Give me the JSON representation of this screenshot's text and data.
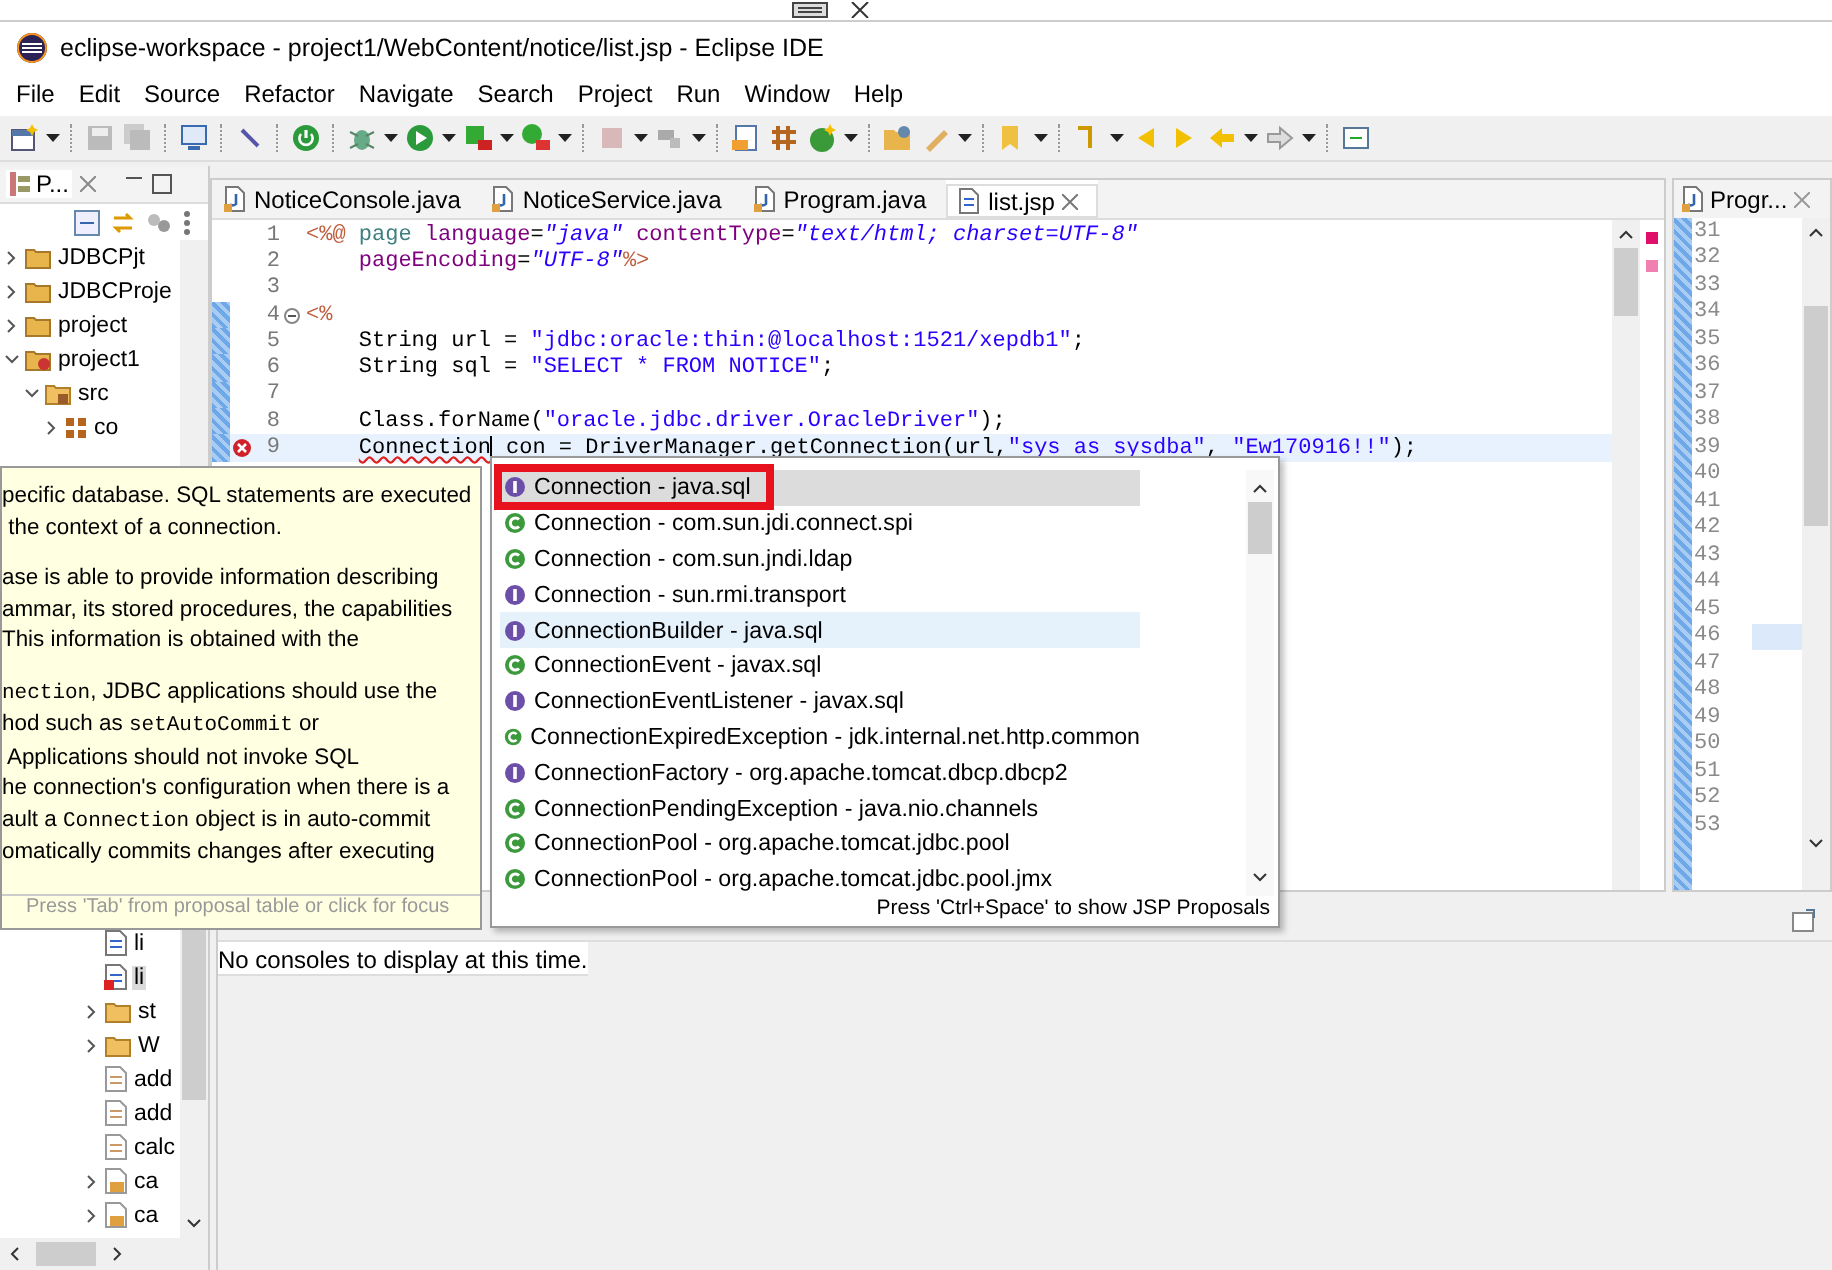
{
  "window": {
    "title": "eclipse-workspace - project1/WebContent/notice/list.jsp - Eclipse IDE"
  },
  "menu": [
    "File",
    "Edit",
    "Source",
    "Refactor",
    "Navigate",
    "Search",
    "Project",
    "Run",
    "Window",
    "Help"
  ],
  "explorer": {
    "tab": "P...",
    "tree": [
      {
        "label": "JDBCPjt",
        "kind": "project",
        "expanded": false,
        "selected": false
      },
      {
        "label": "JDBCProje",
        "kind": "project",
        "expanded": false,
        "selected": false
      },
      {
        "label": "project",
        "kind": "project",
        "expanded": false,
        "selected": false
      },
      {
        "label": "project1",
        "kind": "webproject",
        "expanded": true,
        "selected": false,
        "children": [
          {
            "label": "src",
            "kind": "srcfolder",
            "expanded": true,
            "selected": false,
            "children": [
              {
                "label": "co",
                "kind": "package",
                "expanded": false,
                "selected": false
              }
            ]
          }
        ]
      }
    ],
    "tree_lower": [
      {
        "label": "li",
        "kind": "jsp",
        "selected": false
      },
      {
        "label": "li",
        "kind": "jsperror",
        "selected": true
      },
      {
        "label": "st",
        "kind": "folder",
        "expanded": false,
        "selected": false
      },
      {
        "label": "W",
        "kind": "folder",
        "expanded": false,
        "selected": false
      },
      {
        "label": "add",
        "kind": "file",
        "selected": false
      },
      {
        "label": "add",
        "kind": "file",
        "selected": false
      },
      {
        "label": "calc",
        "kind": "file",
        "selected": false
      },
      {
        "label": "ca",
        "kind": "javafile",
        "expanded": false,
        "selected": false
      },
      {
        "label": "ca",
        "kind": "javafile",
        "expanded": false,
        "selected": false
      }
    ]
  },
  "editor": {
    "tabs": [
      {
        "label": "NoticeConsole.java",
        "kind": "java",
        "selected": false
      },
      {
        "label": "NoticeService.java",
        "kind": "java",
        "selected": false
      },
      {
        "label": "Program.java",
        "kind": "java",
        "selected": false
      },
      {
        "label": "list.jsp",
        "kind": "jsp",
        "selected": true
      }
    ],
    "lines": [
      {
        "number": "1",
        "changed": false,
        "current": false,
        "error": false,
        "fold": false,
        "segments": [
          {
            "kind": "tag",
            "text": "<%@"
          },
          {
            "kind": "dir",
            "text": " page"
          },
          {
            "kind": "attr",
            "text": " language"
          },
          {
            "kind": "plain",
            "text": "="
          },
          {
            "kind": "str",
            "text": "\"java\""
          },
          {
            "kind": "attr",
            "text": " contentType"
          },
          {
            "kind": "plain",
            "text": "="
          },
          {
            "kind": "str",
            "text": "\"text/html; charset=UTF-8\""
          }
        ]
      },
      {
        "number": "2",
        "changed": false,
        "current": false,
        "error": false,
        "fold": false,
        "segments": [
          {
            "kind": "attr",
            "text": "    pageEncoding"
          },
          {
            "kind": "plain",
            "text": "="
          },
          {
            "kind": "str",
            "text": "\"UTF-8\""
          },
          {
            "kind": "tag",
            "text": "%>"
          }
        ]
      },
      {
        "number": "3",
        "changed": false,
        "current": false,
        "error": false,
        "fold": false
      },
      {
        "number": "4",
        "changed": true,
        "current": false,
        "error": false,
        "fold": true,
        "segments": [
          {
            "kind": "tag",
            "text": "<%"
          }
        ]
      },
      {
        "number": "5",
        "changed": true,
        "current": false,
        "error": false,
        "fold": false,
        "segments": [
          {
            "kind": "plain",
            "text": "    String url = "
          },
          {
            "kind": "jstr",
            "text": "\"jdbc:oracle:thin:@localhost:1521/xepdb1\""
          },
          {
            "kind": "plain",
            "text": ";"
          }
        ]
      },
      {
        "number": "6",
        "changed": true,
        "current": false,
        "error": false,
        "fold": false,
        "segments": [
          {
            "kind": "plain",
            "text": "    String sql = "
          },
          {
            "kind": "jstr",
            "text": "\"SELECT * FROM NOTICE\""
          },
          {
            "kind": "plain",
            "text": ";"
          }
        ]
      },
      {
        "number": "7",
        "changed": true,
        "current": false,
        "error": false,
        "fold": false
      },
      {
        "number": "8",
        "changed": true,
        "current": false,
        "error": false,
        "fold": false,
        "segments": [
          {
            "kind": "plain",
            "text": "    Class.forName("
          },
          {
            "kind": "jstr",
            "text": "\"oracle.jdbc.driver.OracleDriver\""
          },
          {
            "kind": "plain",
            "text": ");"
          }
        ]
      },
      {
        "number": "9",
        "changed": true,
        "current": true,
        "error": true,
        "fold": false,
        "segments": [
          {
            "kind": "err",
            "text": "    Connection",
            "caret": true
          },
          {
            "kind": "plain",
            "text": " con = DriverManager.getConnection(url,"
          },
          {
            "kind": "jstr",
            "text": "\"sys as sysdba\""
          },
          {
            "kind": "plain",
            "text": ", "
          },
          {
            "kind": "jstr",
            "text": "\"Ew170916!!\""
          },
          {
            "kind": "plain",
            "text": ");"
          }
        ]
      }
    ]
  },
  "side_editor": {
    "tab": "Progr...",
    "lines": [
      {
        "number": "31",
        "current": false
      },
      {
        "number": "32",
        "current": false
      },
      {
        "number": "33",
        "current": false
      },
      {
        "number": "34",
        "current": false
      },
      {
        "number": "35",
        "current": false
      },
      {
        "number": "36",
        "current": false
      },
      {
        "number": "37",
        "current": false
      },
      {
        "number": "38",
        "current": false
      },
      {
        "number": "39",
        "current": false
      },
      {
        "number": "40",
        "current": false
      },
      {
        "number": "41",
        "current": false
      },
      {
        "number": "42",
        "current": false
      },
      {
        "number": "43",
        "current": false
      },
      {
        "number": "44",
        "current": false
      },
      {
        "number": "45",
        "current": false
      },
      {
        "number": "46",
        "current": true
      },
      {
        "number": "47",
        "current": false
      },
      {
        "number": "48",
        "current": false
      },
      {
        "number": "49",
        "current": false
      },
      {
        "number": "50",
        "current": false
      },
      {
        "number": "51",
        "current": false
      },
      {
        "number": "52",
        "current": false
      },
      {
        "number": "53",
        "current": false
      }
    ]
  },
  "console": {
    "message": "No consoles to display at this time."
  },
  "javadoc": {
    "paragraphs": [
      [
        [
          {
            "kind": "text",
            "text": "pecific database. SQL statements are executed"
          }
        ],
        [
          {
            "kind": "text",
            "text": " the context of a connection."
          }
        ]
      ],
      [
        [
          {
            "kind": "text",
            "text": "ase is able to provide information describing"
          }
        ],
        [
          {
            "kind": "text",
            "text": "ammar, its stored procedures, the capabilities"
          }
        ],
        [
          {
            "kind": "text",
            "text": "This information is obtained with the"
          }
        ]
      ],
      [
        [
          {
            "kind": "code",
            "text": "nection"
          },
          {
            "kind": "text",
            "text": ", JDBC applications should use the"
          }
        ],
        [
          {
            "kind": "text",
            "text": "hod such as "
          },
          {
            "kind": "code",
            "text": "setAutoCommit"
          },
          {
            "kind": "text",
            "text": " or"
          }
        ],
        [
          {
            "kind": "text",
            "text": " Applications should not invoke SQL"
          }
        ],
        [
          {
            "kind": "text",
            "text": "he connection's configuration when there is a"
          }
        ],
        [
          {
            "kind": "text",
            "text": "ault a "
          },
          {
            "kind": "code",
            "text": "Connection"
          },
          {
            "kind": "text",
            "text": " object is in auto-commit"
          }
        ],
        [
          {
            "kind": "text",
            "text": "omatically commits changes after executing"
          }
        ]
      ]
    ],
    "footer": "Press 'Tab' from proposal table or click for focus"
  },
  "proposals": {
    "items": [
      {
        "kind": "interface",
        "label": "Connection - java.sql",
        "selected": true,
        "hovered": false,
        "callout": true
      },
      {
        "kind": "class",
        "label": "Connection - com.sun.jdi.connect.spi",
        "selected": false,
        "hovered": false,
        "callout": false
      },
      {
        "kind": "class",
        "label": "Connection - com.sun.jndi.ldap",
        "selected": false,
        "hovered": false,
        "callout": false
      },
      {
        "kind": "interface",
        "label": "Connection - sun.rmi.transport",
        "selected": false,
        "hovered": false,
        "callout": false
      },
      {
        "kind": "interface",
        "label": "ConnectionBuilder - java.sql",
        "selected": false,
        "hovered": true,
        "callout": false
      },
      {
        "kind": "class",
        "label": "ConnectionEvent - javax.sql",
        "selected": false,
        "hovered": false,
        "callout": false
      },
      {
        "kind": "interface",
        "label": "ConnectionEventListener - javax.sql",
        "selected": false,
        "hovered": false,
        "callout": false
      },
      {
        "kind": "class",
        "label": "ConnectionExpiredException - jdk.internal.net.http.common",
        "selected": false,
        "hovered": false,
        "callout": false
      },
      {
        "kind": "interface",
        "label": "ConnectionFactory - org.apache.tomcat.dbcp.dbcp2",
        "selected": false,
        "hovered": false,
        "callout": false
      },
      {
        "kind": "class",
        "label": "ConnectionPendingException - java.nio.channels",
        "selected": false,
        "hovered": false,
        "callout": false
      },
      {
        "kind": "class",
        "label": "ConnectionPool - org.apache.tomcat.jdbc.pool",
        "selected": false,
        "hovered": false,
        "callout": false
      },
      {
        "kind": "class",
        "label": "ConnectionPool - org.apache.tomcat.jdbc.pool.jmx",
        "selected": false,
        "hovered": false,
        "callout": false
      }
    ],
    "footer": "Press 'Ctrl+Space' to show JSP Proposals"
  }
}
